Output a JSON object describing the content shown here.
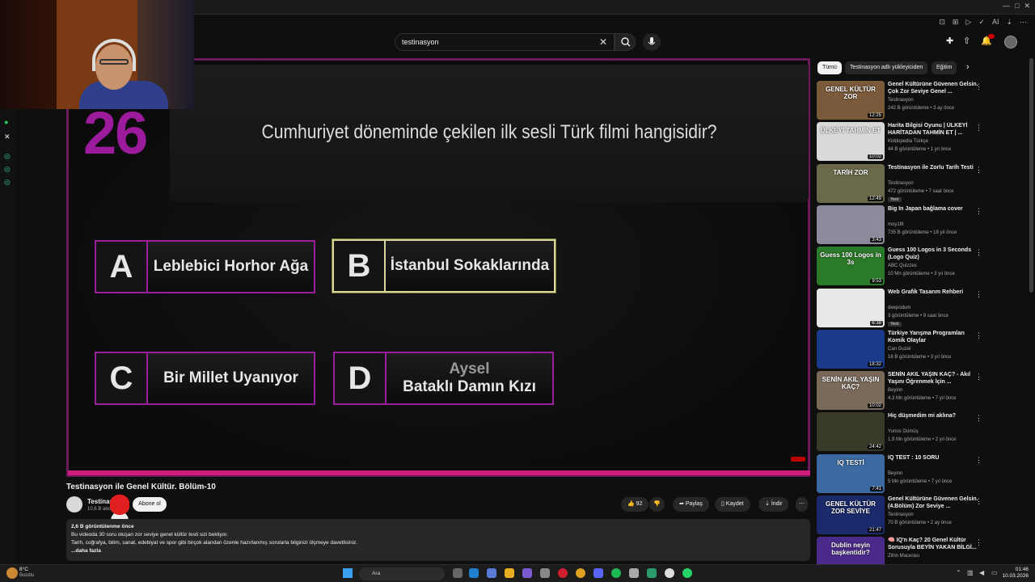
{
  "browser": {
    "icons": [
      "≡",
      "⊡",
      "⊞",
      "▷",
      "✓",
      "AI",
      "—",
      "⌂",
      "⇣",
      "✎",
      "⋯",
      "□"
    ]
  },
  "search": {
    "value": "testinasyon"
  },
  "header_icons": {
    "create": "✚",
    "upload": "⇧",
    "notifications": "🔔"
  },
  "video": {
    "number": "26",
    "question": "Cumhuriyet döneminde çekilen ilk sesli Türk filmi hangisidir?",
    "answers": [
      {
        "letter": "A",
        "text": "Leblebici Horhor Ağa",
        "sub": ""
      },
      {
        "letter": "B",
        "text": "İstanbul Sokaklarında",
        "sub": ""
      },
      {
        "letter": "C",
        "text": "Bir Millet Uyanıyor",
        "sub": ""
      },
      {
        "letter": "D",
        "text": "Bataklı Damın Kızı",
        "sub": "Aysel"
      }
    ],
    "selected_answer": "B",
    "colors": {
      "border": "#9a1f9a",
      "accent": "#d01c7c",
      "selected": "#d8d89a"
    }
  },
  "info": {
    "title": "Testinasyon ile Genel Kültür. Bölüm-10",
    "channel": "Testinas",
    "subs": "10,6 B abo",
    "subscribe": "Abone ol",
    "likes": "92",
    "share": "Paylaş",
    "save": "Kaydet",
    "download": "İndir",
    "more": "⋯"
  },
  "description": {
    "line1": "2,6 B görüntülenme  önce",
    "line2": "Bu videoda 30 soru     oluşan zor seviye genel kültür testi sizi bekliyor.",
    "line3": "Tarih, coğrafya, bilim, sanat, edebiyat ve spor gibi birçok alandan özenle hazırlanmış sorularla bilginizi ölçmeye davetlisiniz.",
    "more": "...daha fazla"
  },
  "chips": [
    "Tümü",
    "Testinasyon adlı yükleyiciden",
    "Eğitim"
  ],
  "sidebar": [
    {
      "title": "Genel Kültürüne Güvenen Gelsin. Çok Zor Seviye Genel ...",
      "channel": "Testinasyon",
      "meta": "242 B görüntüleme • 3 ay önce",
      "duration": "12:25",
      "badge": "",
      "thumb": "#7a5a3a",
      "thumb_text": "GENEL KÜLTÜR ZOR"
    },
    {
      "title": "Harita Bilgisi Oyunu | ÜLKEYİ HARİTADAN TAHMİN ET | ...",
      "channel": "Kiddopedia Türkçe",
      "meta": "44 B görüntüleme • 1 yıl önce",
      "duration": "10:02",
      "badge": "",
      "thumb": "#d9d9d9",
      "thumb_text": "ÜLKEYİ TAHMİN ET"
    },
    {
      "title": "Testinasyon ile Zorlu Tarih Testi",
      "channel": "Testinasyon",
      "meta": "472 görüntüleme • 7 saat önce",
      "duration": "12:49",
      "badge": "Yeni",
      "thumb": "#6a6a4a",
      "thumb_text": "TARİH ZOR"
    },
    {
      "title": "Big In Japan bağlama cover",
      "channel": "moy18t",
      "meta": "735 B görüntüleme • 18 yıl önce",
      "duration": "3:43",
      "badge": "",
      "thumb": "#8a8a9a",
      "thumb_text": ""
    },
    {
      "title": "Guess 100 Logos in 3 Seconds (Logo Quiz)",
      "channel": "ABC Quizzes",
      "meta": "10 Mn görüntüleme • 3 yıl önce",
      "duration": "9:53",
      "badge": "",
      "thumb": "#2a7a2a",
      "thumb_text": "Guess 100 Logos in 3s"
    },
    {
      "title": "Web Grafik Tasarım Rehberi",
      "channel": "deepodum",
      "meta": "3 görüntüleme • 9 saat önce",
      "duration": "6:38",
      "badge": "Yeni",
      "thumb": "#e8e8e8",
      "thumb_text": ""
    },
    {
      "title": "Türkiye Yarışma Programları Komik Olaylar",
      "channel": "Can Guzel",
      "meta": "16 B görüntüleme • 3 yıl önce",
      "duration": "18:32",
      "badge": "",
      "thumb": "#1a3a8a",
      "thumb_text": ""
    },
    {
      "title": "SENİN AKIL YAŞIN KAÇ? - Akıl Yaşını Öğrenmek İçin ...",
      "channel": "Beyinn",
      "meta": "4,3 Mn görüntüleme • 7 yıl önce",
      "duration": "10:02",
      "badge": "",
      "thumb": "#7a6a5a",
      "thumb_text": "SENİN AKIL YAŞIN KAÇ?"
    },
    {
      "title": "Hiç düşmedim mi aklına?",
      "channel": "Yunus Gümüş",
      "meta": "1,9 Mn görüntüleme • 2 yıl önce",
      "duration": "24:42",
      "badge": "",
      "thumb": "#3a3a2a",
      "thumb_text": ""
    },
    {
      "title": "IQ TEST : 10 SORU",
      "channel": "Beyinn",
      "meta": "5 Mn görüntüleme • 7 yıl önce",
      "duration": "7:41",
      "badge": "",
      "thumb": "#3a6aa0",
      "thumb_text": "IQ TESTİ"
    },
    {
      "title": "Genel Kültürüne Güvenen Gelsin. (4.Bölüm) Zor Seviye ...",
      "channel": "Testinasyon",
      "meta": "70 B görüntüleme • 2 ay önce",
      "duration": "21:47",
      "badge": "",
      "thumb": "#1a2a6a",
      "thumb_text": "GENEL KÜLTÜR ZOR SEVİYE"
    },
    {
      "title": "🧠 IQ'n Kaç? 20 Genel Kültür Sorusuyla BEYİN YAKAN BİLGİ...",
      "channel": "Zihin Macerası",
      "meta": "",
      "duration": "",
      "badge": "",
      "thumb": "#4a2a8a",
      "thumb_text": "Dublin neyin başkentidir?"
    }
  ],
  "taskbar": {
    "temp": "8°C",
    "weather": "Bulutlu",
    "search": "Ara",
    "time": "01:46",
    "date": "10.03.2026"
  }
}
